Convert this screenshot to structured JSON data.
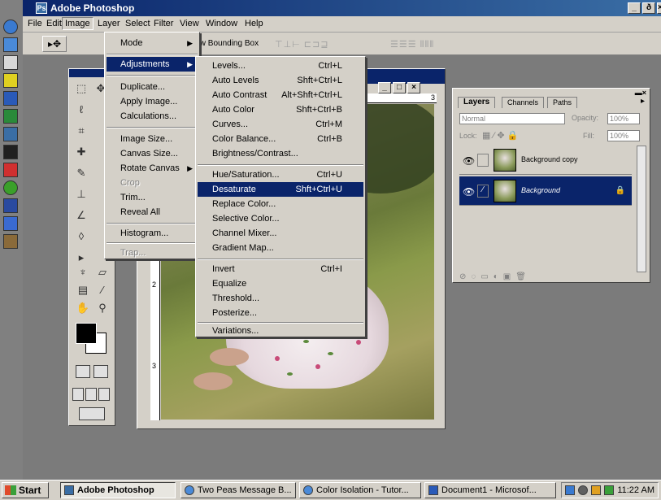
{
  "window": {
    "title": "Adobe Photoshop",
    "min": "_",
    "max": "ð",
    "close": "×"
  },
  "menubar": [
    "File",
    "Edit",
    "Image",
    "Layer",
    "Select",
    "Filter",
    "View",
    "Window",
    "Help"
  ],
  "options_bar": {
    "bounding_box_label": "Show Bounding Box"
  },
  "image_menu": {
    "items": [
      {
        "label": "Mode",
        "submenu": true
      },
      {
        "label": "Adjustments",
        "submenu": true,
        "highlighted": true
      },
      {
        "label": "Duplicate..."
      },
      {
        "label": "Apply Image..."
      },
      {
        "label": "Calculations..."
      },
      {
        "label": "Image Size..."
      },
      {
        "label": "Canvas Size..."
      },
      {
        "label": "Rotate Canvas",
        "submenu": true
      },
      {
        "label": "Crop",
        "disabled": true
      },
      {
        "label": "Trim..."
      },
      {
        "label": "Reveal All"
      },
      {
        "label": "Histogram..."
      },
      {
        "label": "Trap...",
        "disabled": true
      }
    ]
  },
  "adjustments_menu": {
    "items": [
      {
        "label": "Levels...",
        "shortcut": "Ctrl+L"
      },
      {
        "label": "Auto Levels",
        "shortcut": "Shft+Ctrl+L"
      },
      {
        "label": "Auto Contrast",
        "shortcut": "Alt+Shft+Ctrl+L"
      },
      {
        "label": "Auto Color",
        "shortcut": "Shft+Ctrl+B"
      },
      {
        "label": "Curves...",
        "shortcut": "Ctrl+M"
      },
      {
        "label": "Color Balance...",
        "shortcut": "Ctrl+B"
      },
      {
        "label": "Brightness/Contrast...",
        "shortcut": ""
      },
      {
        "label": "Hue/Saturation...",
        "shortcut": "Ctrl+U"
      },
      {
        "label": "Desaturate",
        "shortcut": "Shft+Ctrl+U",
        "highlighted": true
      },
      {
        "label": "Replace Color...",
        "shortcut": ""
      },
      {
        "label": "Selective Color...",
        "shortcut": ""
      },
      {
        "label": "Channel Mixer...",
        "shortcut": ""
      },
      {
        "label": "Gradient Map...",
        "shortcut": ""
      },
      {
        "label": "Invert",
        "shortcut": "Ctrl+I"
      },
      {
        "label": "Equalize",
        "shortcut": ""
      },
      {
        "label": "Threshold...",
        "shortcut": ""
      },
      {
        "label": "Posterize...",
        "shortcut": ""
      },
      {
        "label": "Variations...",
        "shortcut": ""
      }
    ]
  },
  "ruler": {
    "top_mark": "3",
    "left_mark_1": "2",
    "left_mark_2": "3"
  },
  "layers_palette": {
    "tabs": [
      "Layers",
      "Channels",
      "Paths"
    ],
    "blend_mode": "Normal",
    "opacity_label": "Opacity:",
    "opacity_value": "100%",
    "lock_label": "Lock:",
    "fill_label": "Fill:",
    "fill_value": "100%",
    "layers": [
      {
        "name": "Background copy",
        "selected": false
      },
      {
        "name": "Background",
        "selected": true
      }
    ]
  },
  "taskbar": {
    "start": "Start",
    "tasks": [
      {
        "label": "Adobe Photoshop",
        "active": true
      },
      {
        "label": "Two Peas Message B...",
        "active": false
      },
      {
        "label": "Color Isolation - Tutor...",
        "active": false
      },
      {
        "label": "Document1 - Microsof...",
        "active": false
      }
    ],
    "clock": "11:22 AM"
  }
}
